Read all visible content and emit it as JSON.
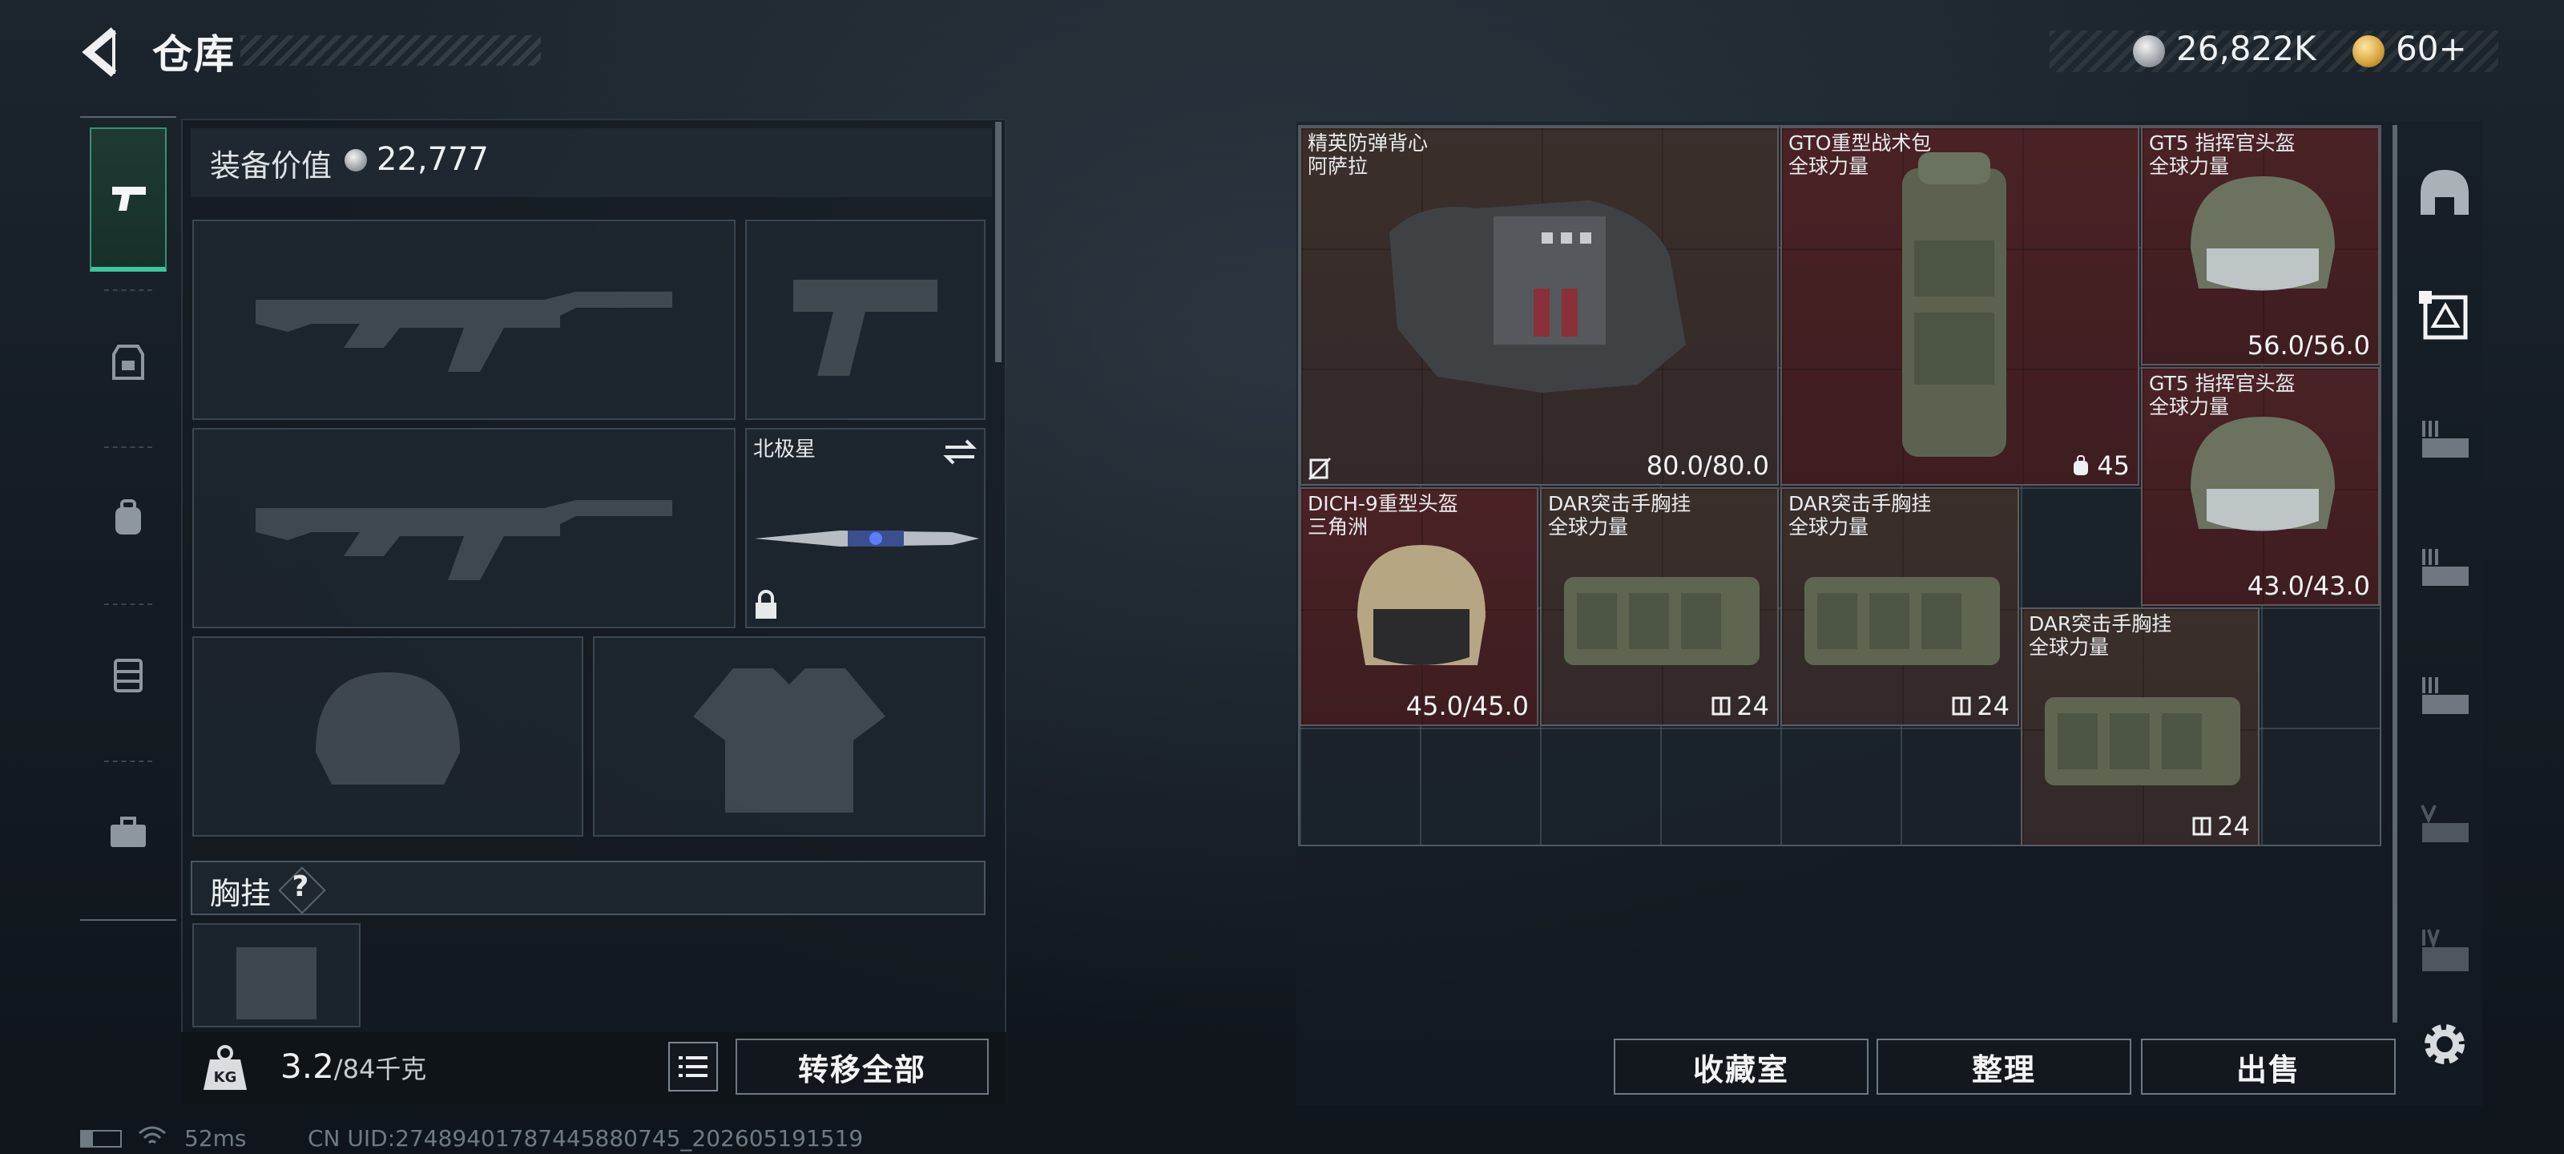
{
  "header": {
    "title": "仓库"
  },
  "currency": [
    {
      "icon": "silver-coin-icon",
      "value": "26,822K"
    },
    {
      "icon": "gold-coin-icon",
      "value": "60+"
    }
  ],
  "loadout": {
    "value_label": "装备价值",
    "value": "22,777",
    "melee_name": "北极星",
    "chest_label": "胸挂",
    "help": "?"
  },
  "weight": {
    "current": "3.2",
    "max": "/84千克"
  },
  "buttons": {
    "transfer_all": "转移全部",
    "collection": "收藏室",
    "organize": "整理",
    "sell": "出售"
  },
  "inventory": {
    "items": [
      {
        "name1": "精英防弹背心",
        "name2": "阿萨拉",
        "stat": "80.0/80.0",
        "rarity": "brown"
      },
      {
        "name1": "GTO重型战术包",
        "name2": "全球力量",
        "stat": "45",
        "rarity": "red"
      },
      {
        "name1": "GT5 指挥官头盔",
        "name2": "全球力量",
        "stat": "56.0/56.0",
        "rarity": "red"
      },
      {
        "name1": "GT5 指挥官头盔",
        "name2": "全球力量",
        "stat": "43.0/43.0",
        "rarity": "red"
      },
      {
        "name1": "DICH-9重型头盔",
        "name2": "三角洲",
        "stat": "45.0/45.0",
        "rarity": "red"
      },
      {
        "name1": "DAR突击手胸挂",
        "name2": "全球力量",
        "stat": "24",
        "rarity": "brown"
      },
      {
        "name1": "DAR突击手胸挂",
        "name2": "全球力量",
        "stat": "24",
        "rarity": "brown"
      },
      {
        "name1": "DAR突击手胸挂",
        "name2": "全球力量",
        "stat": "24",
        "rarity": "brown"
      }
    ]
  },
  "status": {
    "ping": "52ms",
    "uid": "CN UID:2748940178744588074​5_202605191519"
  }
}
